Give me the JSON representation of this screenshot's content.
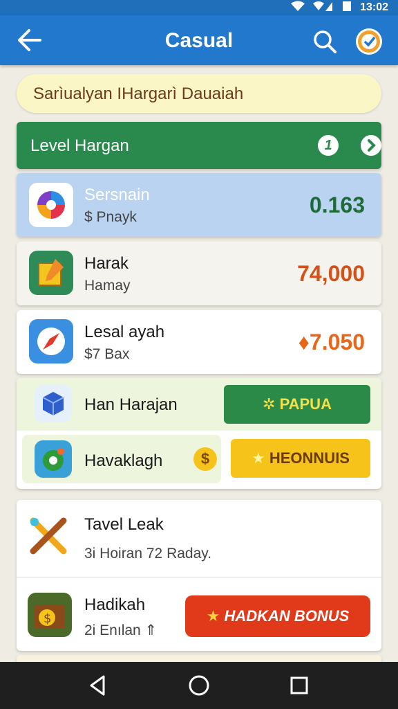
{
  "status_bar": {
    "time": "13:02"
  },
  "app_bar": {
    "title": "Casual",
    "back_icon": "arrow-left-icon",
    "search_icon": "search-icon",
    "avatar_icon": "profile-badge-icon"
  },
  "banner": {
    "text": "Sarìualyan IHargarì Dauaiah"
  },
  "level_bar": {
    "label": "Level Hargan",
    "info_label": "1",
    "next_icon": "chevron-right-icon"
  },
  "rows": [
    {
      "title": "Sersnain",
      "subtitle": "$ Pnayk",
      "value": "0.163",
      "icon": "swirl-app-icon",
      "value_color": "#1e6b3a"
    },
    {
      "title": "Harak",
      "subtitle": "Hamay",
      "value": "74,000",
      "icon": "pencil-box-app-icon",
      "value_color": "#d4521a"
    },
    {
      "title": "Lesal ayah",
      "subtitle": "$7 Bax",
      "value": "7.050",
      "value_prefix": "♦",
      "icon": "compass-app-icon",
      "value_color": "#e8661a"
    }
  ],
  "bonus_rows": [
    {
      "title": "Han Harajan",
      "icon": "cube-app-icon",
      "button": "PAPUA",
      "button_icon": "gear-star-icon"
    },
    {
      "title": "Havaklagh",
      "icon": "gear-app-icon",
      "coin_icon": "dollar-coin-icon",
      "button": "HEONNUIS",
      "button_icon": "star-icon"
    }
  ],
  "bottom_rows": [
    {
      "title": "Tavel Leak",
      "subtitle": "3i Hoiran 72 Raday.",
      "icon": "crossed-tools-icon"
    },
    {
      "title": "Hadikah",
      "subtitle": "2i Enılan ⇑",
      "icon": "treasure-box-icon",
      "button": "HADKAN BONUS",
      "button_icon": "star-icon"
    }
  ],
  "colors": {
    "app_bar": "#2178cc",
    "level_bar": "#2a8a4e",
    "highlight_row": "#b9d3f1",
    "green_button": "#2b8a47",
    "yellow_button": "#f6c31a",
    "red_button": "#e03a1a"
  }
}
